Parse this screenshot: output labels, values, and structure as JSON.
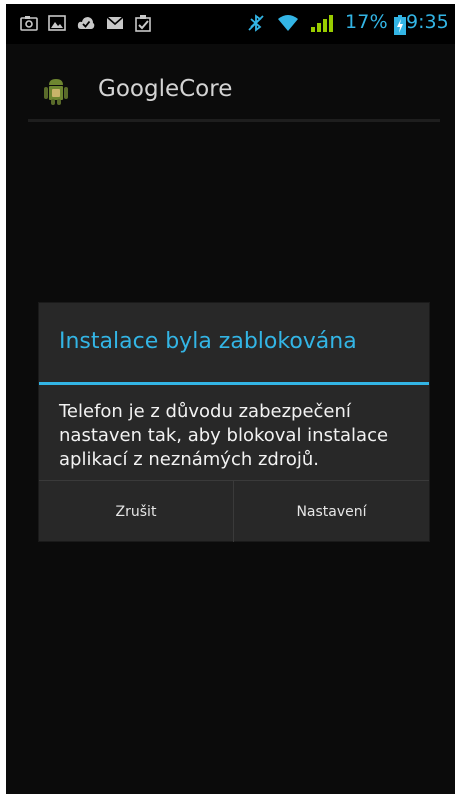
{
  "status_bar": {
    "notification_icons": [
      "camera-icon",
      "image-icon",
      "cloud-check-icon",
      "mail-icon",
      "clipboard-check-icon"
    ],
    "system_icons": [
      "bluetooth-mute-icon",
      "wifi-icon",
      "signal-icon",
      "battery-charging-icon"
    ],
    "battery_percent": "17%",
    "time": "9:35",
    "accent_color": "#33b5e5"
  },
  "action_bar": {
    "app_icon": "android-icon",
    "title": "GoogleCore"
  },
  "dialog": {
    "title": "Instalace byla zablokována",
    "message": "Telefon je z důvodu zabezpečení nastaven tak, aby blokoval instalace aplikací z neznámých zdrojů.",
    "cancel_label": "Zrušit",
    "settings_label": "Nastavení"
  }
}
